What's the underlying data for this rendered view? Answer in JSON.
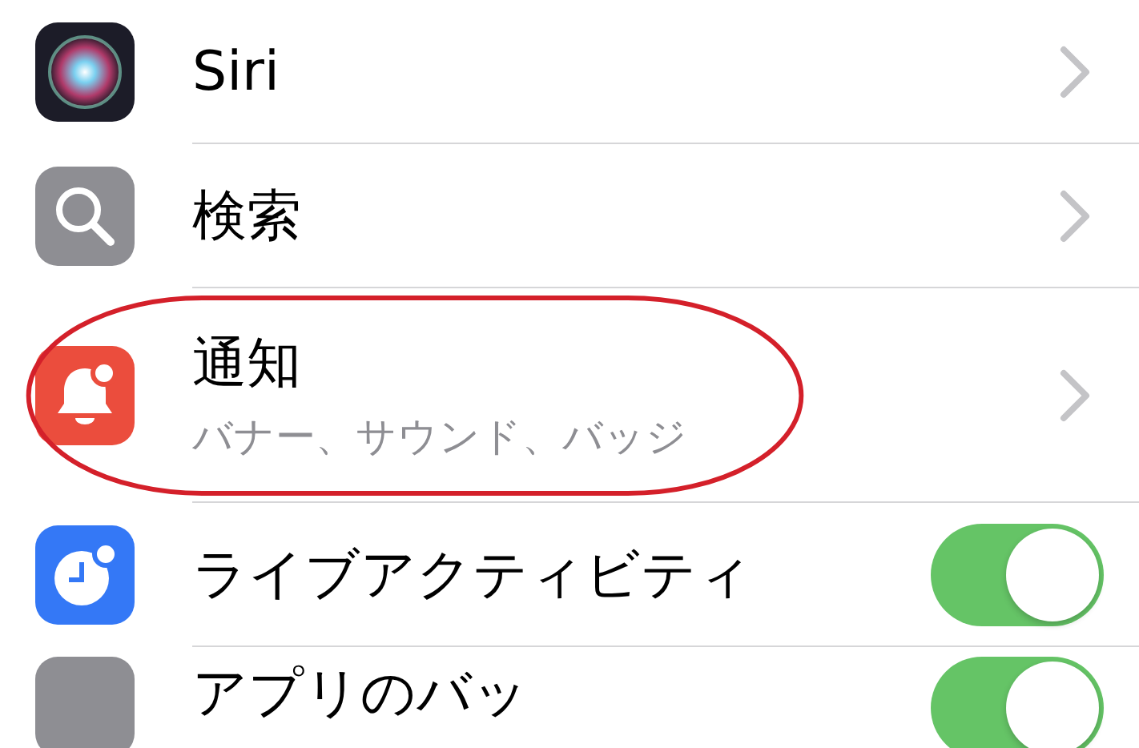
{
  "rows": [
    {
      "kind": "link",
      "title": "Siri",
      "highlighted": false
    },
    {
      "kind": "link",
      "title": "検索",
      "highlighted": false
    },
    {
      "kind": "link",
      "title": "通知",
      "subtitle": "バナー、サウンド、バッジ",
      "highlighted": true
    },
    {
      "kind": "toggle",
      "title": "ライブアクティビティ",
      "on": true,
      "highlighted": false
    },
    {
      "kind": "toggle",
      "title": "アプリのバッ",
      "on": true,
      "highlighted": false
    }
  ]
}
